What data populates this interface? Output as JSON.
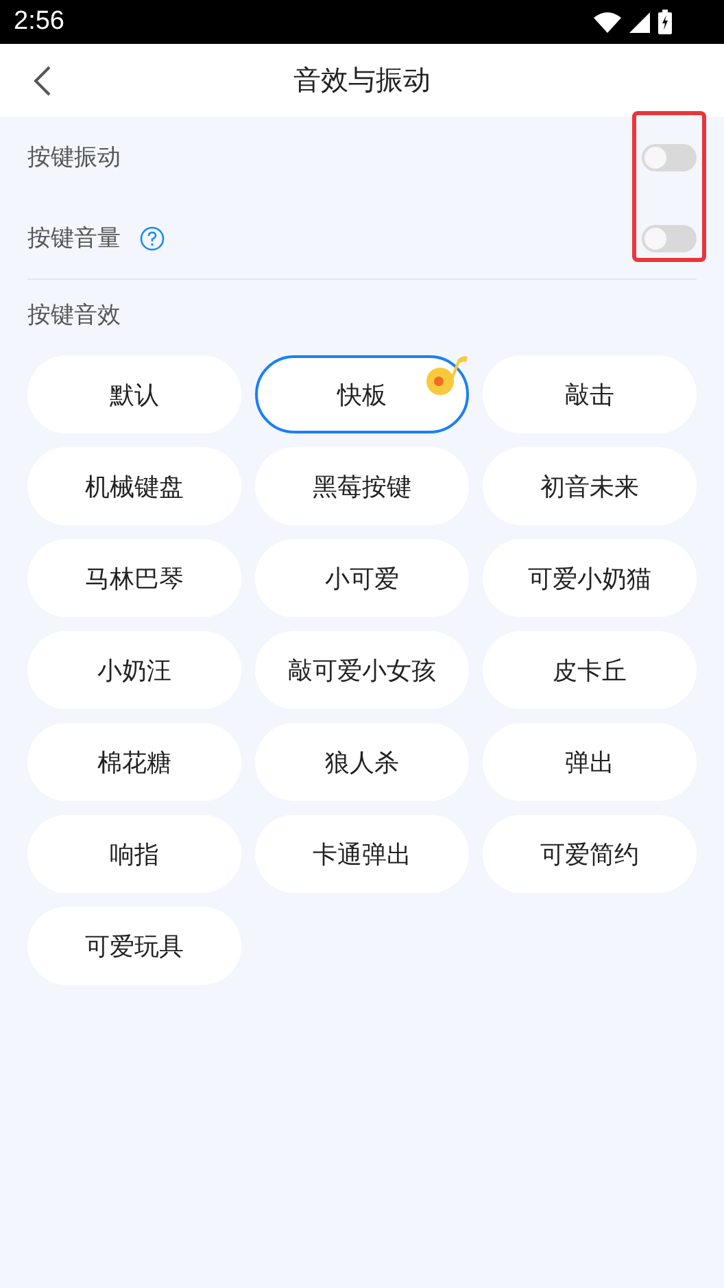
{
  "status_bar": {
    "time": "2:56"
  },
  "header": {
    "title": "音效与振动"
  },
  "settings": [
    {
      "label": "按键振动",
      "help": false,
      "on": false
    },
    {
      "label": "按键音量",
      "help": true,
      "on": false
    }
  ],
  "section_title": "按键音效",
  "sounds": [
    {
      "label": "默认",
      "selected": false
    },
    {
      "label": "快板",
      "selected": true
    },
    {
      "label": "敲击",
      "selected": false
    },
    {
      "label": "机械键盘",
      "selected": false
    },
    {
      "label": "黑莓按键",
      "selected": false
    },
    {
      "label": "初音未来",
      "selected": false
    },
    {
      "label": "马林巴琴",
      "selected": false
    },
    {
      "label": "小可爱",
      "selected": false
    },
    {
      "label": "可爱小奶猫",
      "selected": false
    },
    {
      "label": "小奶汪",
      "selected": false
    },
    {
      "label": "敲可爱小女孩",
      "selected": false
    },
    {
      "label": "皮卡丘",
      "selected": false
    },
    {
      "label": "棉花糖",
      "selected": false
    },
    {
      "label": "狼人杀",
      "selected": false
    },
    {
      "label": "弹出",
      "selected": false
    },
    {
      "label": "响指",
      "selected": false
    },
    {
      "label": "卡通弹出",
      "selected": false
    },
    {
      "label": "可爱简约",
      "selected": false
    },
    {
      "label": "可爱玩具",
      "selected": false
    }
  ]
}
